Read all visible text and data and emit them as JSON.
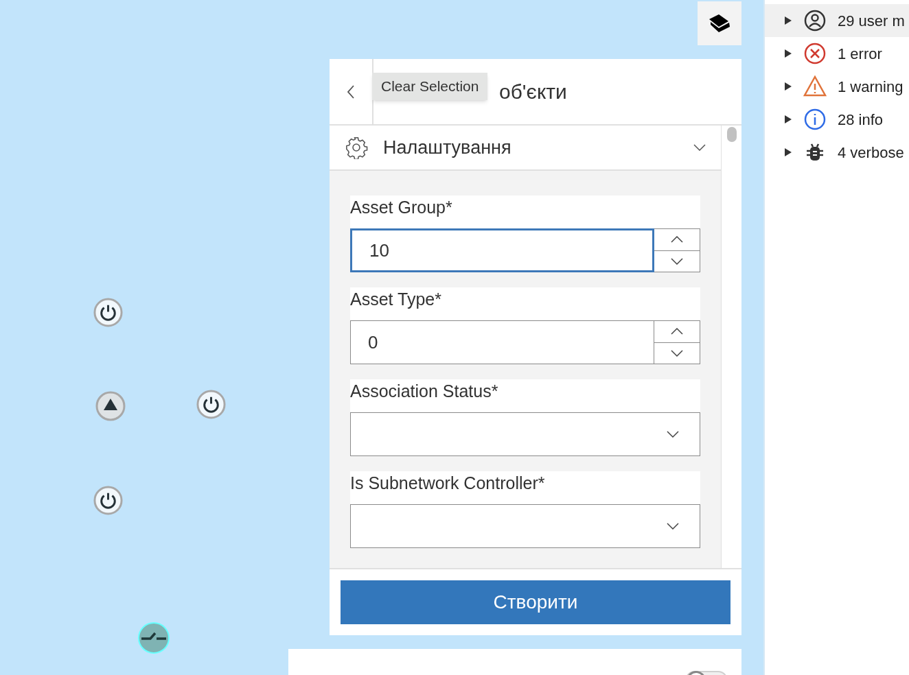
{
  "map": {
    "markers": [
      {
        "kind": "power"
      },
      {
        "kind": "triangle"
      },
      {
        "kind": "power"
      },
      {
        "kind": "power"
      },
      {
        "kind": "switch"
      }
    ]
  },
  "panel": {
    "title": "об'єкти",
    "tooltip": "Clear Selection",
    "section": {
      "label": "Налаштування",
      "expanded": false
    },
    "fields": [
      {
        "kind": "number",
        "label": "Asset Group*",
        "value": "10",
        "focused": true
      },
      {
        "kind": "number",
        "label": "Asset Type*",
        "value": "0",
        "focused": false
      },
      {
        "kind": "select",
        "label": "Association Status*"
      },
      {
        "kind": "select",
        "label": "Is Subnetwork Controller*"
      }
    ],
    "submit": "Створити"
  },
  "second_panel": {
    "toggle": {
      "on": false
    }
  },
  "console": [
    {
      "kind": "user",
      "label": "29 user m",
      "selected": true
    },
    {
      "kind": "error",
      "label": "1 error",
      "selected": false
    },
    {
      "kind": "warning",
      "label": "1 warning",
      "selected": false
    },
    {
      "kind": "info",
      "label": "28 info",
      "selected": false
    },
    {
      "kind": "verbose",
      "label": "4 verbose",
      "selected": false
    }
  ]
}
